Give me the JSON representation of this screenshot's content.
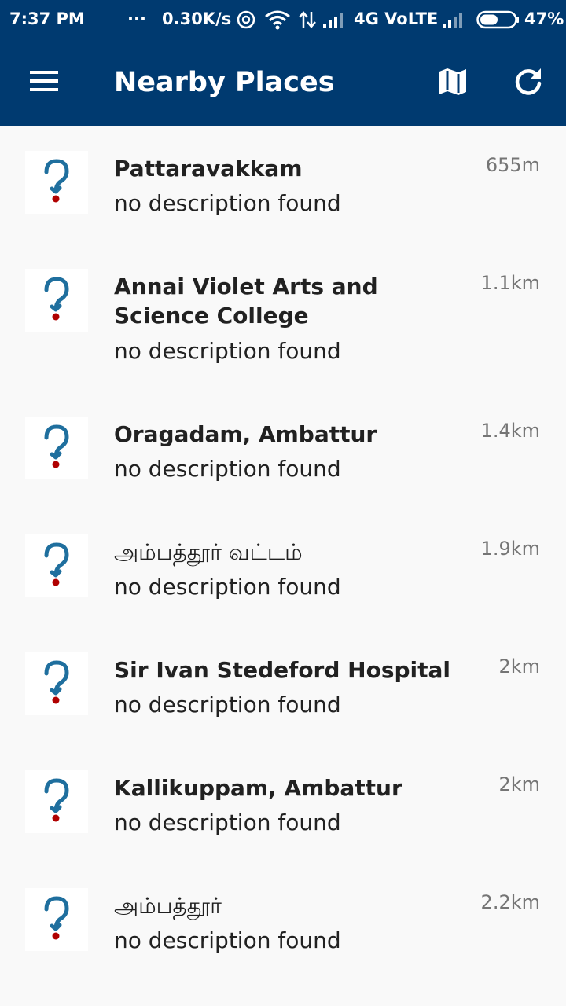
{
  "status_bar": {
    "time": "7:37 PM",
    "dots": "...",
    "speed": "0.30K/s",
    "network": "4G VoLTE",
    "battery": "47%"
  },
  "app_bar": {
    "title": "Nearby Places",
    "menu_icon": "hamburger-menu-icon",
    "map_icon": "map-icon",
    "refresh_icon": "refresh-icon"
  },
  "colors": {
    "primary": "#003a70",
    "background": "#f9f9f9",
    "question_blue": "#1f6f9e",
    "question_dot": "#b00000"
  },
  "places": [
    {
      "name": "Pattaravakkam",
      "description": "no description found",
      "distance": "655m"
    },
    {
      "name": "Annai Violet Arts and Science College",
      "description": "no description found",
      "distance": "1.1km"
    },
    {
      "name": "Oragadam, Ambattur",
      "description": "no description found",
      "distance": "1.4km"
    },
    {
      "name": "அம்பத்தூர் வட்டம்",
      "description": "no description found",
      "distance": "1.9km"
    },
    {
      "name": "Sir Ivan Stedeford Hospital",
      "description": "no description found",
      "distance": "2km"
    },
    {
      "name": "Kallikuppam, Ambattur",
      "description": "no description found",
      "distance": "2km"
    },
    {
      "name": "அம்பத்தூர்",
      "description": "no description found",
      "distance": "2.2km"
    }
  ]
}
